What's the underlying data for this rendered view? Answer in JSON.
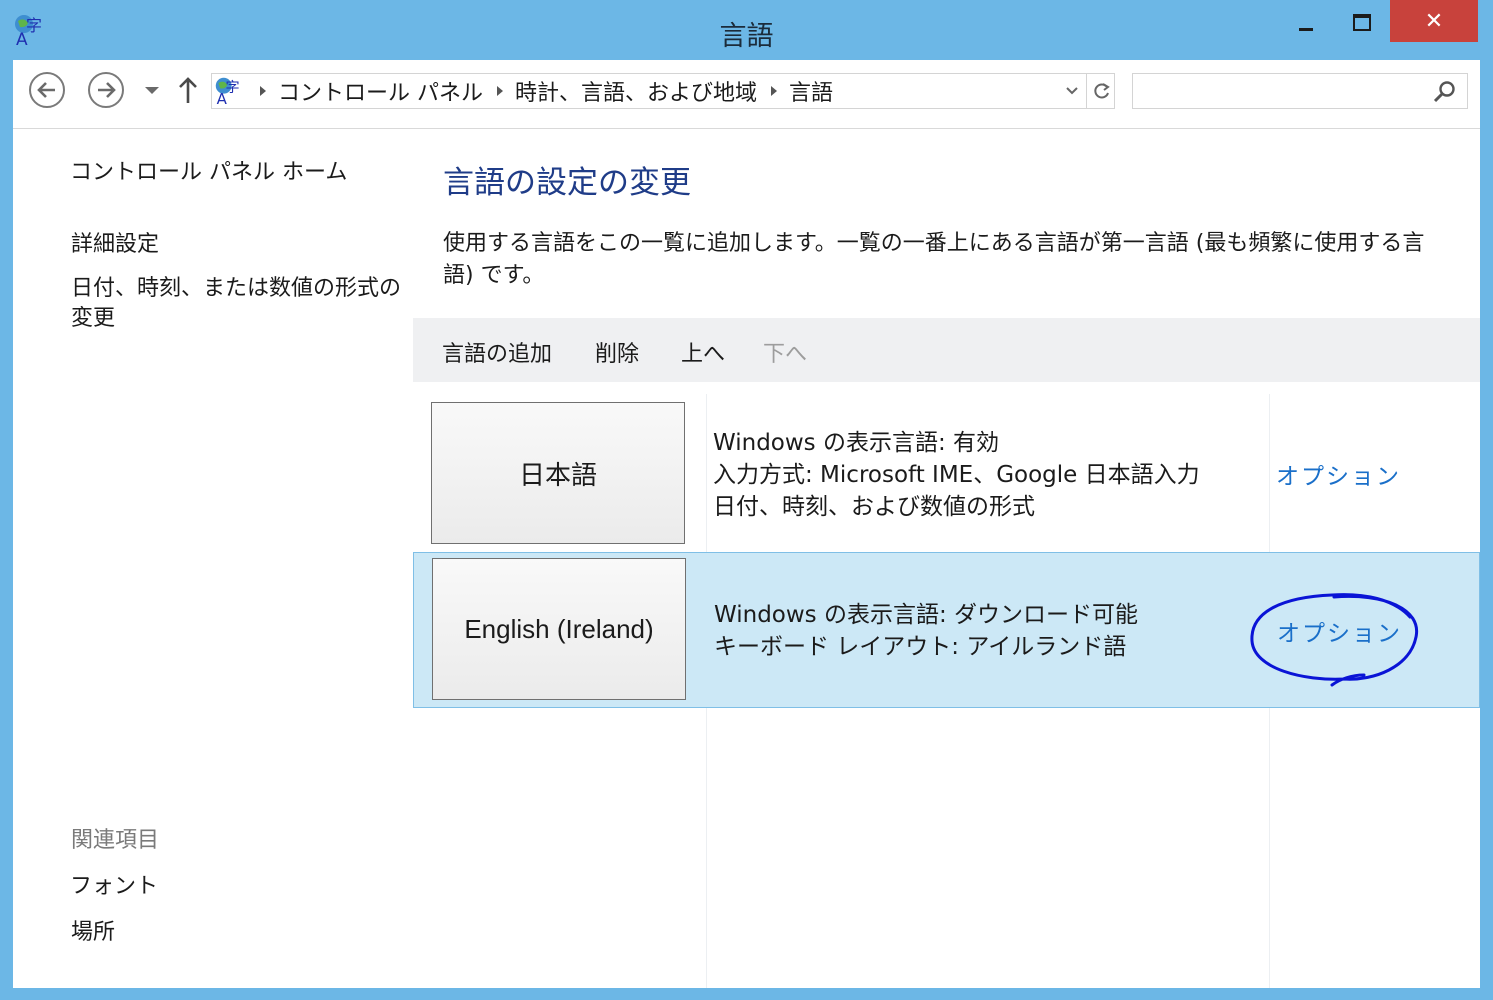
{
  "window": {
    "title": "言語",
    "minimize_icon": "minimize-icon",
    "maximize_icon": "maximize-icon",
    "close_glyph": "✕"
  },
  "address_bar": {
    "breadcrumbs": [
      "コントロール パネル",
      "時計、言語、および地域",
      "言語"
    ],
    "icon": "language-globe-icon"
  },
  "search": {
    "placeholder": ""
  },
  "left_pane": {
    "home": "コントロール パネル ホーム",
    "advanced": "詳細設定",
    "format": "日付、時刻、または数値の形式の変更",
    "related_header": "関連項目",
    "fonts": "フォント",
    "location": "場所"
  },
  "main": {
    "title": "言語の設定の変更",
    "description": "使用する言語をこの一覧に追加します。一覧の一番上にある言語が第一言語 (最も頻繁に使用する言語) です。",
    "toolbar": {
      "add": "言語の追加",
      "remove": "削除",
      "move_up": "上へ",
      "move_down": "下へ"
    },
    "languages": [
      {
        "name": "日本語",
        "lines": [
          "Windows の表示言語: 有効",
          "入力方式: Microsoft IME、Google 日本語入力",
          "日付、時刻、および数値の形式"
        ],
        "options": "オプション"
      },
      {
        "name": "English (Ireland)",
        "lines": [
          "Windows の表示言語: ダウンロード可能",
          "キーボード レイアウト: アイルランド語"
        ],
        "options": "オプション"
      }
    ]
  },
  "colors": {
    "titlebar": "#6cb7e6",
    "close_button": "#c8423c",
    "heading": "#1f3c88",
    "link": "#1a6fc9",
    "selected_row": "#cce8f6",
    "annotation": "#0a14d6"
  }
}
